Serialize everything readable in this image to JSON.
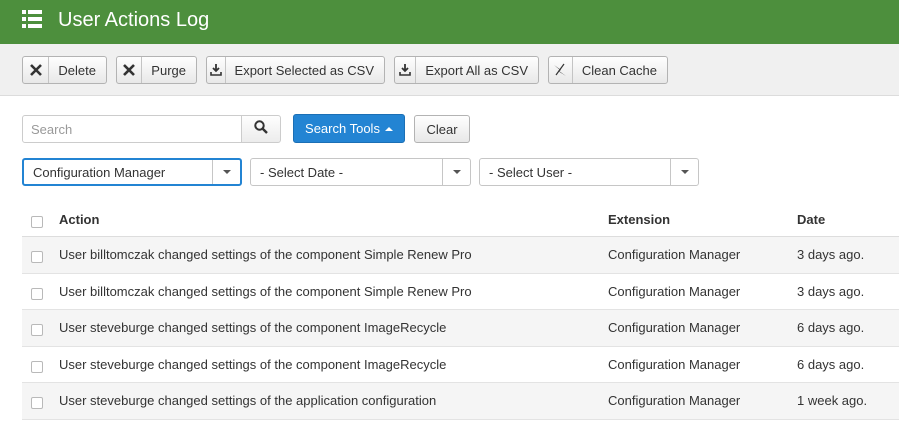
{
  "header": {
    "title": "User Actions Log",
    "icon": "list-icon"
  },
  "toolbar": {
    "buttons": [
      {
        "label": "Delete",
        "icon": "close-icon"
      },
      {
        "label": "Purge",
        "icon": "close-icon"
      },
      {
        "label": "Export Selected as CSV",
        "icon": "download-icon"
      },
      {
        "label": "Export All as CSV",
        "icon": "download-icon"
      },
      {
        "label": "Clean Cache",
        "icon": "flash-icon"
      }
    ]
  },
  "search": {
    "placeholder": "Search",
    "value": "",
    "search_tools_label": "Search Tools",
    "clear_label": "Clear"
  },
  "filters": {
    "extension": "Configuration Manager",
    "date": "- Select Date -",
    "user": "- Select User -"
  },
  "table": {
    "columns": [
      "Action",
      "Extension",
      "Date"
    ],
    "rows": [
      {
        "action": "User billtomczak changed settings of the component Simple Renew Pro",
        "extension": "Configuration Manager",
        "date": "3 days ago."
      },
      {
        "action": "User billtomczak changed settings of the component Simple Renew Pro",
        "extension": "Configuration Manager",
        "date": "3 days ago."
      },
      {
        "action": "User steveburge changed settings of the component ImageRecycle",
        "extension": "Configuration Manager",
        "date": "6 days ago."
      },
      {
        "action": "User steveburge changed settings of the component ImageRecycle",
        "extension": "Configuration Manager",
        "date": "6 days ago."
      },
      {
        "action": "User steveburge changed settings of the application configuration",
        "extension": "Configuration Manager",
        "date": "1 week ago."
      }
    ]
  },
  "colors": {
    "header": "#4d8f3d",
    "primary": "#2384d3",
    "toolbar": "#f0f0f0"
  }
}
